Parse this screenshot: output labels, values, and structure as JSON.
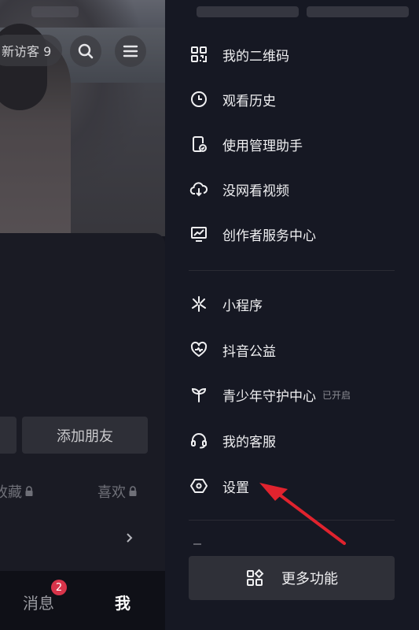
{
  "profile": {
    "visitor_text": "新访客 9",
    "add_friend_label": "添加朋友",
    "tabs": [
      {
        "label": "收藏",
        "locked": true
      },
      {
        "label": "喜欢",
        "locked": true
      }
    ]
  },
  "bottom_nav": {
    "messages_label": "消息",
    "messages_badge": "2",
    "me_label": "我"
  },
  "drawer": {
    "group1": [
      {
        "label": "我的二维码",
        "icon": "qrcode-icon"
      },
      {
        "label": "观看历史",
        "icon": "clock-icon"
      },
      {
        "label": "使用管理助手",
        "icon": "phone-check-icon"
      },
      {
        "label": "没网看视频",
        "icon": "cloud-download-icon"
      },
      {
        "label": "创作者服务中心",
        "icon": "monitor-chart-icon"
      }
    ],
    "group2": [
      {
        "label": "小程序",
        "icon": "mini-program-icon"
      },
      {
        "label": "抖音公益",
        "icon": "heart-charity-icon"
      },
      {
        "label": "青少年守护中心",
        "icon": "sprout-icon",
        "tag": "已开启"
      },
      {
        "label": "我的客服",
        "icon": "headset-icon"
      },
      {
        "label": "设置",
        "icon": "settings-hexagon-icon"
      }
    ],
    "more_label": "更多功能",
    "accent_arrow_color": "#e0232e"
  }
}
